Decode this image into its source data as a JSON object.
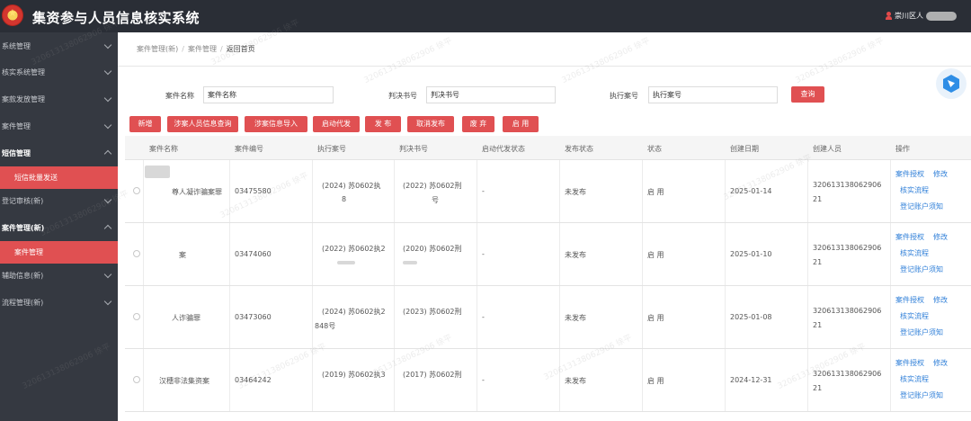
{
  "header": {
    "app_title": "集资参与人员信息核实系统",
    "user_name": "崇川区人",
    "colors": {
      "bar": "#2a2e36",
      "accent": "#e05052"
    }
  },
  "sidebar": {
    "items": [
      {
        "label": "系统管理",
        "state": "collapsed"
      },
      {
        "label": "核实系统管理",
        "state": "collapsed"
      },
      {
        "label": "案款发放管理",
        "state": "collapsed"
      },
      {
        "label": "案件管理",
        "state": "collapsed"
      },
      {
        "label": "短信管理",
        "state": "open"
      },
      {
        "label": "短信批量发送",
        "state": "active"
      },
      {
        "label": "登记审核(新)",
        "state": "collapsed"
      },
      {
        "label": "案件管理(新)",
        "state": "open"
      },
      {
        "label": "案件管理",
        "state": "active"
      },
      {
        "label": "辅助信息(新)",
        "state": "collapsed"
      },
      {
        "label": "流程管理(新)",
        "state": "collapsed"
      }
    ]
  },
  "breadcrumb": {
    "items": [
      "案件管理(新)",
      "案件管理"
    ],
    "current": "返回首页"
  },
  "search": {
    "case_name_label": "案件名称",
    "case_name_placeholder": "案件名称",
    "verdict_label": "判决书号",
    "verdict_placeholder": "判决书号",
    "exec_label": "执行案号",
    "exec_placeholder": "执行案号",
    "query_button": "查询"
  },
  "toolbar": {
    "new": "新增",
    "query_person": "涉案人员信息查询",
    "import": "涉案信息导入",
    "start_dist": "启动代发",
    "publish": "发 布",
    "unpublish": "取消发布",
    "disable": "废 弃",
    "enable": "启 用"
  },
  "table": {
    "headers": [
      "案件名称",
      "案件编号",
      "执行案号",
      "判决书号",
      "启动代发状态",
      "发布状态",
      "状态",
      "创建日期",
      "创建人员",
      "操作"
    ],
    "rows": [
      {
        "name": "尊人凝诈骗案罪",
        "code": "03475580",
        "exec_no_1": "(2024) 苏0602执",
        "exec_no_2": "8",
        "verdict_1": "(2022) 苏0602刑",
        "verdict_2": "号",
        "dist": "-",
        "publish": "未发布",
        "status": "启 用",
        "date": "2025-01-14",
        "creator_1": "320613138062906",
        "creator_2": "21"
      },
      {
        "name": "案",
        "code": "03474060",
        "exec_no_1": "(2022) 苏0602执2",
        "exec_no_2": "",
        "verdict_1": "(2020) 苏0602刑",
        "verdict_2": "",
        "dist": "-",
        "publish": "未发布",
        "status": "启 用",
        "date": "2025-01-10",
        "creator_1": "320613138062906",
        "creator_2": "21"
      },
      {
        "name": "人诈骗罪",
        "code": "03473060",
        "exec_no_1": "(2024) 苏0602执2",
        "exec_no_2": "848号",
        "verdict_1": "(2023) 苏0602刑",
        "verdict_2": "",
        "dist": "-",
        "publish": "未发布",
        "status": "启 用",
        "date": "2025-01-08",
        "creator_1": "320613138062906",
        "creator_2": "21"
      },
      {
        "name": "汉穗非法集资案",
        "code": "03464242",
        "exec_no_1": "(2019) 苏0602执3",
        "exec_no_2": "",
        "verdict_1": "(2017) 苏0602刑",
        "verdict_2": "",
        "dist": "-",
        "publish": "未发布",
        "status": "启 用",
        "date": "2024-12-31",
        "creator_1": "320613138062906",
        "creator_2": "21"
      }
    ],
    "ops": {
      "authorize": "案件授权",
      "edit": "修改",
      "flow": "核实流程",
      "notice": "登记账户须知"
    }
  },
  "watermark": {
    "text": "320613138062906 徐平"
  }
}
